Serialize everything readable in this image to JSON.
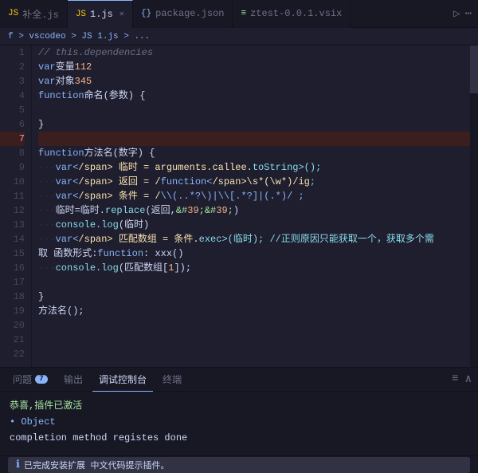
{
  "tabs": [
    {
      "id": "supplement",
      "icon": "JS",
      "iconType": "js",
      "label": "补全.js",
      "active": false,
      "closable": false
    },
    {
      "id": "main",
      "icon": "JS",
      "iconType": "js",
      "label": "1.js",
      "active": true,
      "closable": true
    },
    {
      "id": "package",
      "icon": "{}",
      "iconType": "json",
      "label": "package.json",
      "active": false,
      "closable": false
    },
    {
      "id": "vsix",
      "icon": "≡",
      "iconType": "vsix",
      "label": "ztest-0.0.1.vsix",
      "active": false,
      "closable": false
    }
  ],
  "breadcrumb": {
    "parts": [
      "f >",
      "vscodeo >",
      "JS 1.js >",
      "..."
    ]
  },
  "lines": [
    {
      "num": 1,
      "highlight": false,
      "active": false,
      "content": "// this.dependencies"
    },
    {
      "num": 2,
      "highlight": false,
      "active": false,
      "content": "var 变量112"
    },
    {
      "num": 3,
      "highlight": false,
      "active": false,
      "content": "var 对象345"
    },
    {
      "num": 4,
      "highlight": false,
      "active": false,
      "content": "function 命名(参数) {"
    },
    {
      "num": 5,
      "highlight": false,
      "active": false,
      "content": ""
    },
    {
      "num": 6,
      "highlight": false,
      "active": false,
      "content": "  }"
    },
    {
      "num": 7,
      "highlight": true,
      "active": false,
      "content": ""
    },
    {
      "num": 8,
      "highlight": false,
      "active": false,
      "content": "function 方法名(数字) {"
    },
    {
      "num": 9,
      "highlight": false,
      "active": false,
      "content": "  · · · var 临时 = arguments.callee.toString();"
    },
    {
      "num": 10,
      "highlight": false,
      "active": false,
      "content": "  · · · var 返回 = /function\\s*(\\w*)/ig;"
    },
    {
      "num": 11,
      "highlight": false,
      "active": false,
      "content": "  · · · var 条件 = /\\\\(..*?\\)|\\\\[.*?]|(.*)/ ;"
    },
    {
      "num": 12,
      "highlight": false,
      "active": false,
      "content": "  · · · 临时=临时.replace(返回,'')"
    },
    {
      "num": 13,
      "highlight": false,
      "active": false,
      "content": "  · · · console.log(临时)"
    },
    {
      "num": 14,
      "highlight": false,
      "active": false,
      "content": "  · · · var 匹配数组 = 条件.exec(临时); //正则原因只能获取一个，获取多个需"
    },
    {
      "num": 15,
      "highlight": false,
      "active": false,
      "content": "  取 函数形式: function : xxx()"
    },
    {
      "num": 16,
      "highlight": false,
      "active": false,
      "content": "  · · · console.log(匹配数组[1]);"
    },
    {
      "num": 17,
      "highlight": false,
      "active": false,
      "content": ""
    },
    {
      "num": 18,
      "highlight": false,
      "active": false,
      "content": "  }"
    },
    {
      "num": 19,
      "highlight": false,
      "active": false,
      "content": "方法名();"
    },
    {
      "num": 20,
      "highlight": false,
      "active": false,
      "content": ""
    },
    {
      "num": 21,
      "highlight": false,
      "active": false,
      "content": ""
    },
    {
      "num": 22,
      "highlight": false,
      "active": false,
      "content": ""
    }
  ],
  "panel": {
    "tabs": [
      {
        "id": "problems",
        "label": "问题",
        "badge": "7",
        "active": false
      },
      {
        "id": "output",
        "label": "输出",
        "badge": null,
        "active": false
      },
      {
        "id": "debug",
        "label": "调试控制台",
        "badge": null,
        "active": true
      },
      {
        "id": "terminal",
        "label": "终端",
        "badge": null,
        "active": false
      }
    ],
    "content": [
      {
        "type": "success",
        "text": "恭喜,插件已激活"
      },
      {
        "type": "obj",
        "text": "• Object"
      },
      {
        "type": "plain",
        "text": "completion method registes done"
      }
    ]
  },
  "statusBar": {
    "notification": "已完成安装扩展 中文代码提示插件。",
    "infoIcon": "ℹ"
  }
}
